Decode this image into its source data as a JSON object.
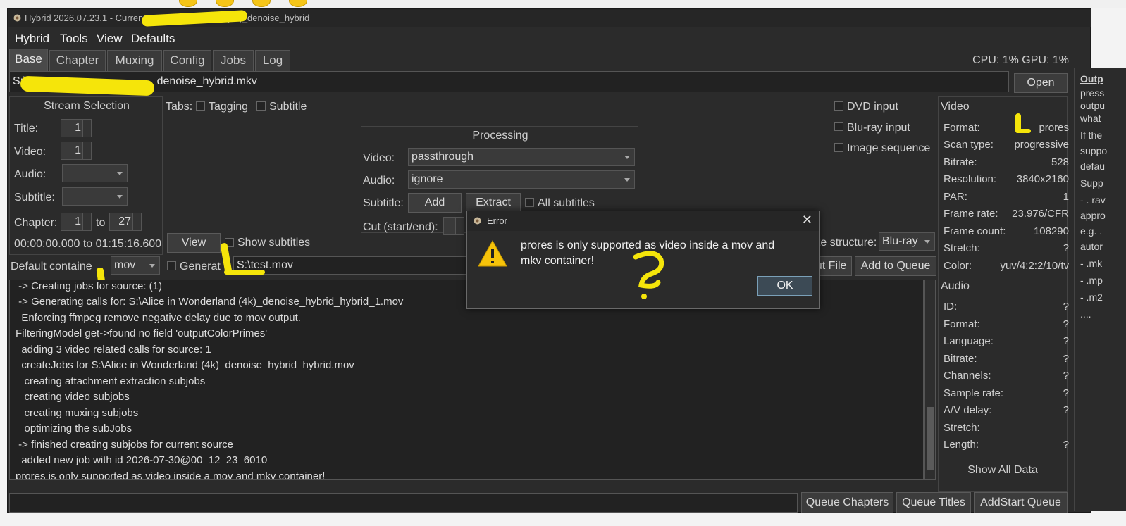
{
  "window": {
    "title_prefix": "Hybrid 2026.07.23.1 - Current In",
    "title_suffix": "(4k)_denoise_hybrid"
  },
  "menu": [
    "Hybrid",
    "Tools",
    "View",
    "Defaults"
  ],
  "tabs": [
    "Base",
    "Chapter",
    "Muxing",
    "Config",
    "Jobs",
    "Log"
  ],
  "status": {
    "cpu_gpu": "CPU: 1% GPU: 1%"
  },
  "source": {
    "path_prefix": "S:\\",
    "path_suffix": "denoise_hybrid.mkv",
    "open_label": "Open"
  },
  "stream_selection": {
    "title": "Stream Selection",
    "title_label": "Title:",
    "title_value": "1",
    "video_label": "Video:",
    "video_value": "1",
    "audio_label": "Audio:",
    "subtitle_label": "Subtitle:",
    "chapter_label": "Chapter:",
    "chapter_from": "1",
    "to_label": "to",
    "chapter_to": "27",
    "time_range": "00:00:00.000 to 01:15:16.600"
  },
  "tabs_row": {
    "label": "Tabs:",
    "tagging": "Tagging",
    "subtitle": "Subtitle"
  },
  "processing": {
    "title": "Processing",
    "video_label": "Video:",
    "video_value": "passthrough",
    "audio_label": "Audio:",
    "audio_value": "ignore",
    "subtitle_label": "Subtitle:",
    "add_label": "Add",
    "extract_label": "Extract",
    "all_subtitles": "All subtitles",
    "cut_label": "Cut (start/end):"
  },
  "inputs": {
    "dvd": "DVD input",
    "bluray": "Blu-ray input",
    "image_seq": "Image sequence"
  },
  "view_row": {
    "view_label": "View",
    "show_subtitles": "Show subtitles",
    "structure_label": "ate structure:",
    "structure_value": "Blu-ray"
  },
  "output_row": {
    "container_label": "Default containe",
    "container_value": "mov",
    "generate_label": "Generat",
    "output_path": "S:\\test.mov",
    "output_file_label": "tput File",
    "add_to_queue": "Add to Queue"
  },
  "log_lines": [
    " -> Creating jobs for source: (1)",
    " -> Generating calls for: S:\\Alice in Wonderland (4k)_denoise_hybrid_hybrid_1.mov",
    "  Enforcing ffmpeg remove negative delay due to mov output.",
    "FilteringModel get->found no field 'outputColorPrimes'",
    "  adding 3 video related calls for source: 1",
    "  createJobs for S:\\Alice in Wonderland (4k)_denoise_hybrid_hybrid.mov",
    "   creating attachment extraction subjobs",
    "   creating video subjobs",
    "   creating muxing subjobs",
    "   optimizing the subJobs",
    " -> finished creating subjobs for current source",
    "  added new job with id 2026-07-30@00_12_23_6010",
    "prores is only supported as video inside a mov and mkv container!"
  ],
  "video_info": {
    "header": "Video",
    "rows": [
      {
        "label": "Format:",
        "value": "prores"
      },
      {
        "label": "Scan type:",
        "value": "progressive"
      },
      {
        "label": "Bitrate:",
        "value": "528"
      },
      {
        "label": "Resolution:",
        "value": "3840x2160"
      },
      {
        "label": "PAR:",
        "value": "1"
      },
      {
        "label": "Frame rate:",
        "value": "23.976/CFR"
      },
      {
        "label": "Frame count:",
        "value": "108290"
      },
      {
        "label": "Stretch:",
        "value": "?"
      },
      {
        "label": "Color:",
        "value": "yuv/4:2:2/10/tv"
      }
    ]
  },
  "audio_info": {
    "header": "Audio",
    "rows": [
      {
        "label": "ID:",
        "value": "?"
      },
      {
        "label": "Format:",
        "value": "?"
      },
      {
        "label": "Language:",
        "value": "?"
      },
      {
        "label": "Bitrate:",
        "value": "?"
      },
      {
        "label": "Channels:",
        "value": "?"
      },
      {
        "label": "Sample rate:",
        "value": "?"
      },
      {
        "label": "A/V delay:",
        "value": "?"
      },
      {
        "label": "Stretch:",
        "value": ""
      },
      {
        "label": "Length:",
        "value": "?"
      }
    ],
    "show_all": "Show All Data"
  },
  "right_doc": [
    "Outp",
    "press",
    "outpu",
    "what",
    "If the",
    "suppo",
    "defau",
    "Supp",
    "- . rav",
    "appro",
    "e.g. .",
    "autor",
    "- .mk",
    "- .mp",
    "- .m2",
    "...."
  ],
  "bottom": {
    "queue_chapters": "Queue Chapters",
    "queue_titles": "Queue Titles",
    "addstart_queue": "AddStart Queue"
  },
  "dialog": {
    "title": "Error",
    "message_line1": "prores is only supported as video inside a mov and",
    "message_line2": "mkv container!",
    "ok_label": "OK"
  }
}
